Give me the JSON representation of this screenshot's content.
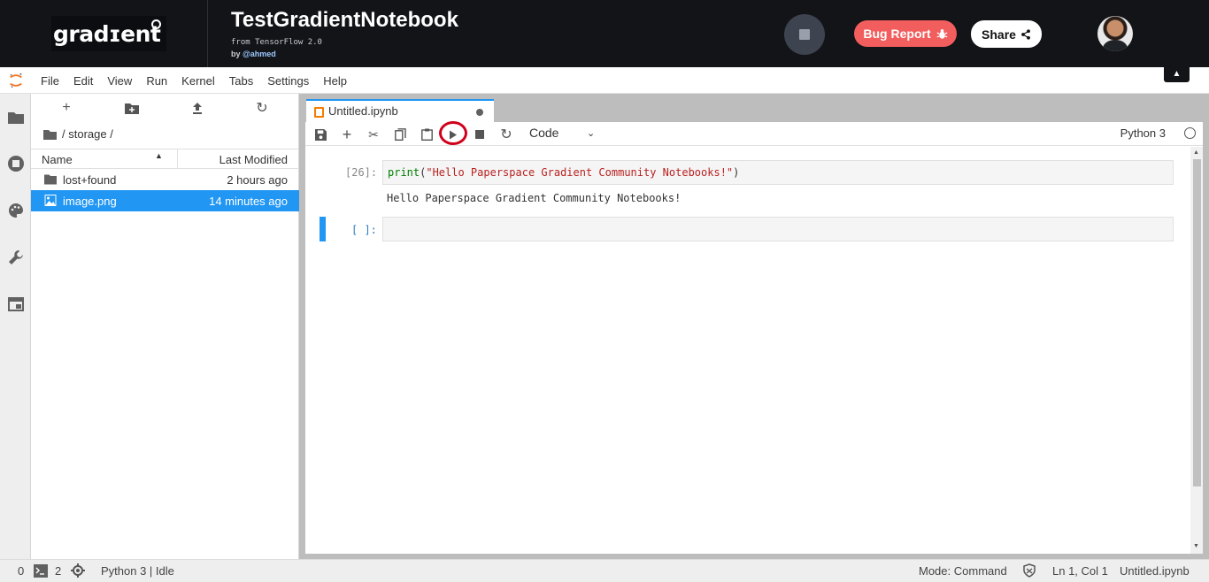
{
  "header": {
    "logo_text": "gradɪent",
    "notebook_title": "TestGradientNotebook",
    "subtitle": "from TensorFlow 2.0",
    "by_prefix": "by ",
    "author": "@ahmed",
    "bug_report_label": "Bug Report",
    "share_label": "Share",
    "colors": {
      "bg": "#121418",
      "bug": "#f25d5d",
      "accent": "#2196f3"
    }
  },
  "menubar": {
    "items": [
      "File",
      "Edit",
      "View",
      "Run",
      "Kernel",
      "Tabs",
      "Settings",
      "Help"
    ]
  },
  "sidebar_icons": [
    "folder-icon",
    "running-icon",
    "palette-icon",
    "wrench-icon",
    "tabs-icon"
  ],
  "filebrowser": {
    "breadcrumb": "/ storage /",
    "col_name": "Name",
    "col_modified": "Last Modified",
    "files": [
      {
        "name": "lost+found",
        "modified": "2 hours ago",
        "type": "folder",
        "selected": false
      },
      {
        "name": "image.png",
        "modified": "14 minutes ago",
        "type": "image",
        "selected": true
      }
    ]
  },
  "notebook": {
    "tab_label": "Untitled.ipynb",
    "cell_type": "Code",
    "kernel": "Python 3",
    "cells": [
      {
        "prompt": "[26]:",
        "code_fn": "print",
        "code_open": "(",
        "code_str": "\"Hello Paperspace Gradient Community Notebooks!\"",
        "code_close": ")",
        "output": "Hello Paperspace Gradient Community Notebooks!"
      },
      {
        "prompt": "[ ]:",
        "code": ""
      }
    ]
  },
  "statusbar": {
    "count_a": "0",
    "count_b": "2",
    "kernel_status": "Python 3 | Idle",
    "mode": "Mode: Command",
    "position": "Ln 1, Col 1",
    "file": "Untitled.ipynb"
  }
}
